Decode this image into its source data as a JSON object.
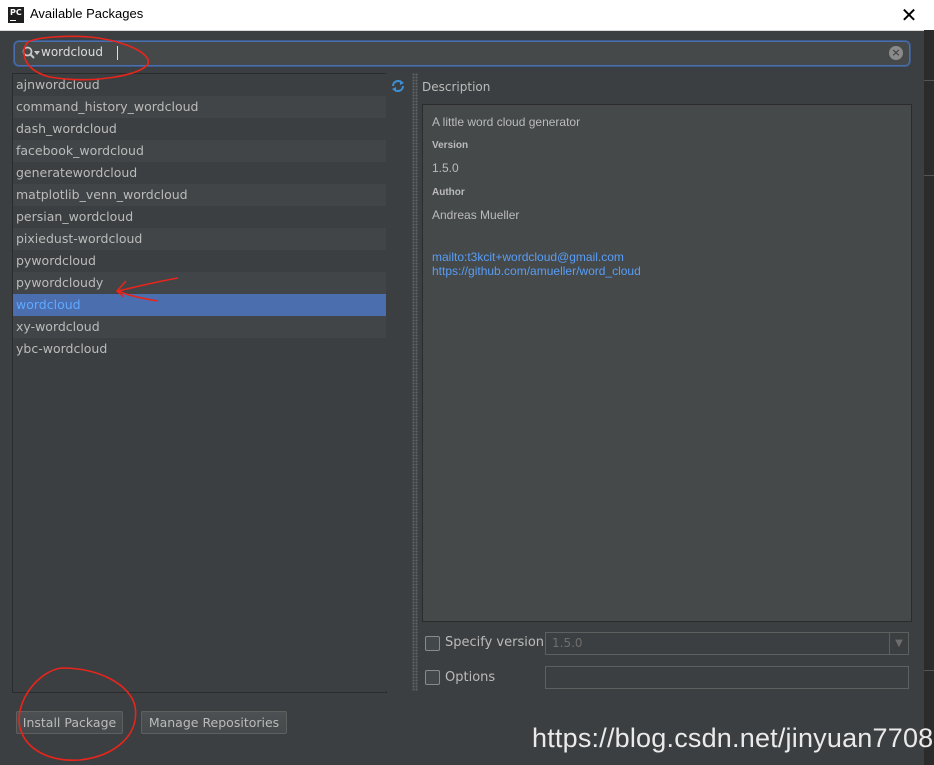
{
  "window": {
    "title": "Available Packages",
    "app_icon_text": "PC"
  },
  "search": {
    "value": "wordcloud"
  },
  "packages": [
    "ajnwordcloud",
    "command_history_wordcloud",
    "dash_wordcloud",
    "facebook_wordcloud",
    "generatewordcloud",
    "matplotlib_venn_wordcloud",
    "persian_wordcloud",
    "pixiedust-wordcloud",
    "pywordcloud",
    "pywordcloudy",
    "wordcloud",
    "xy-wordcloud",
    "ybc-wordcloud"
  ],
  "selected_package": "wordcloud",
  "description": {
    "label": "Description",
    "summary": "A little word cloud generator",
    "version_heading": "Version",
    "version": "1.5.0",
    "author_heading": "Author",
    "author": "Andreas Mueller",
    "email_link": "mailto:t3kcit+wordcloud@gmail.com",
    "home_link": "https://github.com/amueller/word_cloud"
  },
  "options": {
    "specify_version_label": "Specify version",
    "specify_version_value": "1.5.0",
    "options_label": "Options",
    "options_value": ""
  },
  "buttons": {
    "install": "Install Package",
    "manage": "Manage Repositories"
  },
  "watermark": "https://blog.csdn.net/jinyuan7708",
  "colors": {
    "background": "#3c3f41",
    "selection": "#4b6eaf",
    "link": "#589df6",
    "annotation_red": "#e8251c"
  }
}
